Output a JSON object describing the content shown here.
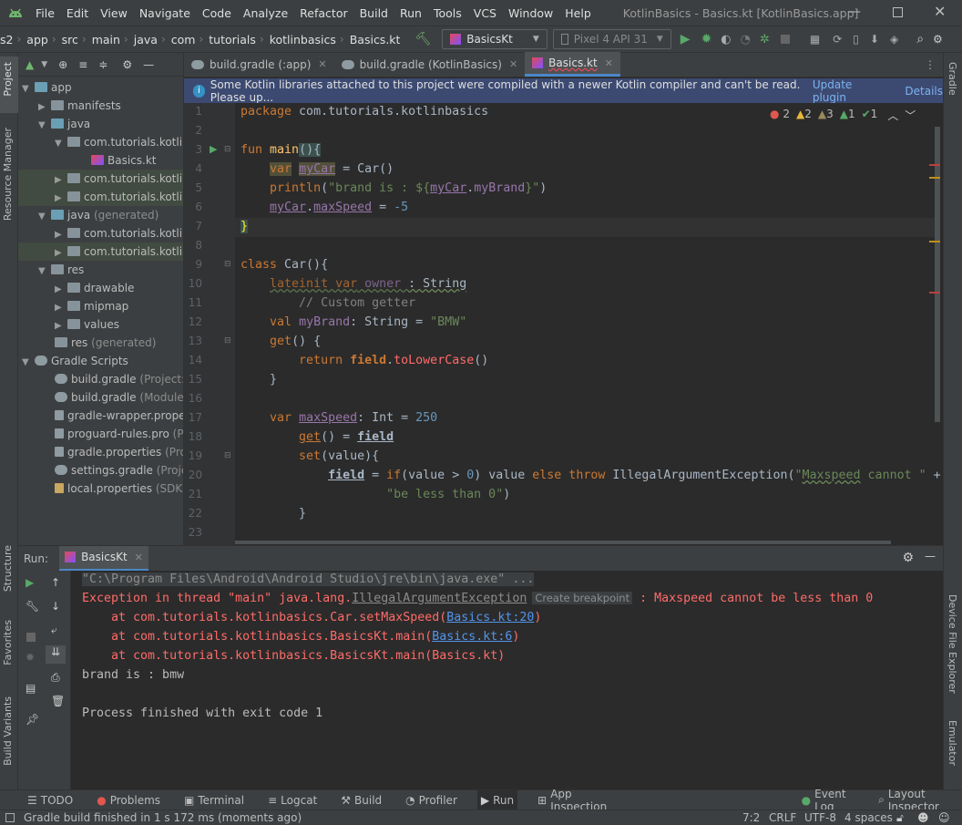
{
  "window": {
    "title": "KotlinBasics - Basics.kt [KotlinBasics.app]"
  },
  "menu": [
    "File",
    "Edit",
    "View",
    "Navigate",
    "Code",
    "Analyze",
    "Refactor",
    "Build",
    "Run",
    "Tools",
    "VCS",
    "Window",
    "Help"
  ],
  "breadcrumbs": [
    "s2",
    "app",
    "src",
    "main",
    "java",
    "com",
    "tutorials",
    "kotlinbasics",
    "Basics.kt"
  ],
  "toolbar": {
    "run_config": "BasicsKt",
    "device": "Pixel 4 API 31"
  },
  "left_strip": {
    "project": "Project",
    "resource_manager": "Resource Manager",
    "structure": "Structure",
    "favorites": "Favorites",
    "build_variants": "Build Variants"
  },
  "right_strip": {
    "gradle": "Gradle",
    "device_file_explorer": "Device File Explorer",
    "emulator": "Emulator"
  },
  "tree": [
    {
      "label": "app",
      "extra": ""
    },
    {
      "label": "manifests",
      "extra": ""
    },
    {
      "label": "java",
      "extra": ""
    },
    {
      "label": "com.tutorials.kotlin",
      "extra": ""
    },
    {
      "label": "Basics.kt",
      "extra": ""
    },
    {
      "label": "com.tutorials.kotlin",
      "extra": ""
    },
    {
      "label": "com.tutorials.kotlin",
      "extra": ""
    },
    {
      "label": "java",
      "extra": "(generated)"
    },
    {
      "label": "com.tutorials.kotlin",
      "extra": ""
    },
    {
      "label": "com.tutorials.kotlin",
      "extra": ""
    },
    {
      "label": "res",
      "extra": ""
    },
    {
      "label": "drawable",
      "extra": ""
    },
    {
      "label": "mipmap",
      "extra": ""
    },
    {
      "label": "values",
      "extra": ""
    },
    {
      "label": "res",
      "extra": "(generated)"
    },
    {
      "label": "Gradle Scripts",
      "extra": ""
    },
    {
      "label": "build.gradle",
      "extra": "(Project: K"
    },
    {
      "label": "build.gradle",
      "extra": "(Module:"
    },
    {
      "label": "gradle-wrapper.proper",
      "extra": ""
    },
    {
      "label": "proguard-rules.pro",
      "extra": "(Pr"
    },
    {
      "label": "gradle.properties",
      "extra": "(Proj"
    },
    {
      "label": "settings.gradle",
      "extra": "(Project"
    },
    {
      "label": "local.properties",
      "extra": "(SDK L"
    }
  ],
  "tabs": [
    "build.gradle (:app)",
    "build.gradle (KotlinBasics)",
    "Basics.kt"
  ],
  "notice": {
    "text": "Some Kotlin libraries attached to this project were compiled with a newer Kotlin compiler and can't be read. Please up...",
    "update": "Update plugin",
    "details": "Details"
  },
  "inspections": {
    "errors": "2",
    "warnings": "2",
    "weak": "3",
    "typos": "1",
    "ok": "1"
  },
  "line_numbers": [
    "1",
    "2",
    "3",
    "4",
    "5",
    "6",
    "7",
    "8",
    "9",
    "10",
    "11",
    "12",
    "13",
    "14",
    "15",
    "16",
    "17",
    "18",
    "19",
    "20",
    "21",
    "22",
    "23"
  ],
  "code": {
    "l1a": "package",
    "l1b": " com.tutorials.kotlinbasics",
    "l3a": "fun",
    "l3b": " main",
    "l3c": "(){",
    "l4a": "var",
    "l4b": " ",
    "l4c": "myCar",
    "l4d": " = Car()",
    "l5a": "println",
    "l5b": "(",
    "l5c": "\"brand is : ${",
    "l5d": "myCar",
    "l5e": ".",
    "l5f": "myBrand",
    "l5g": "}\"",
    "l5h": ")",
    "l6a": "myCar",
    "l6b": ".",
    "l6c": "maxSpeed",
    "l6d": " = ",
    "l6e": "-5",
    "l7": "}",
    "l9a": "class",
    "l9b": " Car(){",
    "l10a": "lateinit var",
    "l10b": " owner ",
    "l10c": ": String",
    "l11": "// Custom getter",
    "l12a": "val",
    "l12b": " myBrand",
    "l12c": ": String = ",
    "l12d": "\"BMW\"",
    "l13a": "get",
    "l13b": "() {",
    "l14a": "return",
    "l14b": " ",
    "l14c": "field",
    "l14d": ".",
    "l14e": "toLowerCase",
    "l14f": "()",
    "l15": "}",
    "l17a": "var",
    "l17b": " ",
    "l17c": "maxSpeed",
    "l17d": ": Int = ",
    "l17e": "250",
    "l18a": "get",
    "l18b": "() = ",
    "l18c": "field",
    "l19a": "set",
    "l19b": "(value){",
    "l20a": "field",
    "l20b": " = ",
    "l20c": "if",
    "l20d": "(value > ",
    "l20e": "0",
    "l20f": ") value ",
    "l20g": "else throw",
    "l20h": " IllegalArgumentException(",
    "l20i": "\"",
    "l20j": "Maxspeed",
    "l20k": " cannot \"",
    "l20l": " +",
    "l21": "\"be less than 0\"",
    "l21b": ")",
    "l22": "}"
  },
  "run": {
    "label": "Run:",
    "tab": "BasicsKt"
  },
  "console": {
    "cmd": "\"C:\\Program Files\\Android\\Android Studio\\jre\\bin\\java.exe\" ...",
    "exc_prefix": "Exception in thread \"main\" java.lang.",
    "exc_class": "IllegalArgumentException",
    "hint": "Create breakpoint",
    "exc_msg": " : Maxspeed cannot be less than 0",
    "st1a": "    at com.tutorials.kotlinbasics.Car.setMaxSpeed(",
    "st1b": "Basics.kt:20",
    "st1c": ")",
    "st2a": "    at com.tutorials.kotlinbasics.BasicsKt.main(",
    "st2b": "Basics.kt:6",
    "st2c": ")",
    "st3": "    at com.tutorials.kotlinbasics.BasicsKt.main(Basics.kt)",
    "out": "brand is : bmw",
    "exit": "Process finished with exit code 1"
  },
  "bottom_tabs": [
    "TODO",
    "Problems",
    "Terminal",
    "Logcat",
    "Build",
    "Profiler",
    "Run",
    "App Inspection"
  ],
  "bottom_right": [
    "Event Log",
    "Layout Inspector"
  ],
  "status": {
    "message": "Gradle build finished in 1 s 172 ms (moments ago)",
    "position": "7:2",
    "line_sep": "CRLF",
    "encoding": "UTF-8",
    "indent": "4 spaces"
  },
  "colors": {
    "accent": "#4a88c7",
    "error": "#ff6b68",
    "keyword": "#cc7832",
    "string": "#6a8759",
    "number": "#6897bb"
  }
}
